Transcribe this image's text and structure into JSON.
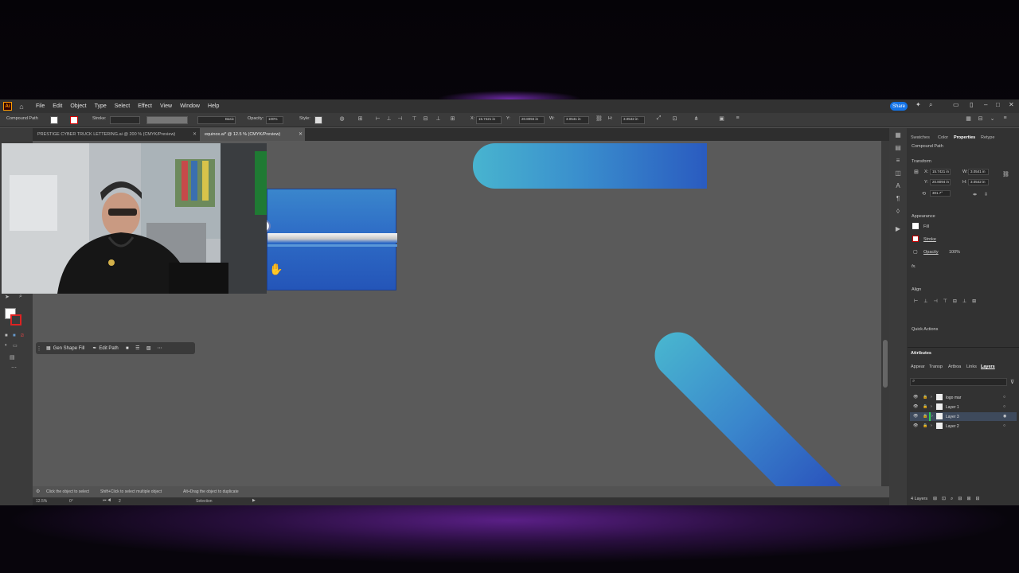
{
  "app": {
    "logo": "Ai",
    "menu": [
      "File",
      "Edit",
      "Object",
      "Type",
      "Select",
      "Effect",
      "View",
      "Window",
      "Help"
    ],
    "share_label": "Share"
  },
  "control_bar": {
    "selection_type": "Compound Path",
    "stroke_label": "Stroke:",
    "stroke_profile": "Basic",
    "opacity_label": "Opacity:",
    "opacity_value": "100%",
    "style_label": "Style:",
    "x_label": "X:",
    "x_value": "15.7421 in",
    "y_label": "Y:",
    "y_value": "20.8094 in",
    "w_label": "W:",
    "w_value": "3.0541 in",
    "h_label": "H:",
    "h_value": "3.0542 in"
  },
  "tabs": [
    {
      "label": "PRESTIGE CYBER TRUCK LETTERING.ai @ 200 % (CMYK/Preview)",
      "active": false
    },
    {
      "label": "equinox.ai* @ 12.5 % (CMYK/Preview)",
      "active": true
    }
  ],
  "context_bar": {
    "gen_shape_fill": "Gen Shape Fill",
    "edit_path": "Edit Path"
  },
  "status": {
    "hint_1": "Click the object to select",
    "hint_2": "Shift+Click to select multiple object",
    "hint_3": "Alt+Drag the object to duplicate",
    "zoom": "12.5%",
    "rotation": "0°",
    "artboard": "2",
    "tool": "Selection"
  },
  "properties": {
    "tabs": [
      "Swatches",
      "Color",
      "Properties",
      "Retype"
    ],
    "active_tab": "Properties",
    "object_type": "Compound Path",
    "transform_label": "Transform",
    "x_label": "X:",
    "x_value": "15.7421 in",
    "y_label": "Y:",
    "y_value": "20.8094 in",
    "w_label": "W:",
    "w_value": "3.0541 in",
    "h_label": "H:",
    "h_value": "3.0542 in",
    "rotate_value": "301.7°",
    "appearance_label": "Appearance",
    "fill_label": "Fill",
    "stroke_label": "Stroke",
    "opacity_label": "Opacity",
    "opacity_value": "100%",
    "fx_label": "fx.",
    "align_label": "Align",
    "quick_actions_label": "Quick Actions"
  },
  "attributes": {
    "title": "Attributes",
    "tabs": [
      "Appear",
      "Transp",
      "Artboa",
      "Links",
      "Layers"
    ],
    "active_tab": "Layers",
    "layers": [
      {
        "name": "logo mar",
        "selected": false
      },
      {
        "name": "Layer 1",
        "selected": false
      },
      {
        "name": "Layer 3",
        "selected": true
      },
      {
        "name": "Layer 2",
        "selected": false
      }
    ],
    "layer_count": "4 Layers"
  },
  "colors": {
    "accent": "#1473e6",
    "gradient_light": "#48b4cf",
    "gradient_dark": "#2a52bc"
  }
}
